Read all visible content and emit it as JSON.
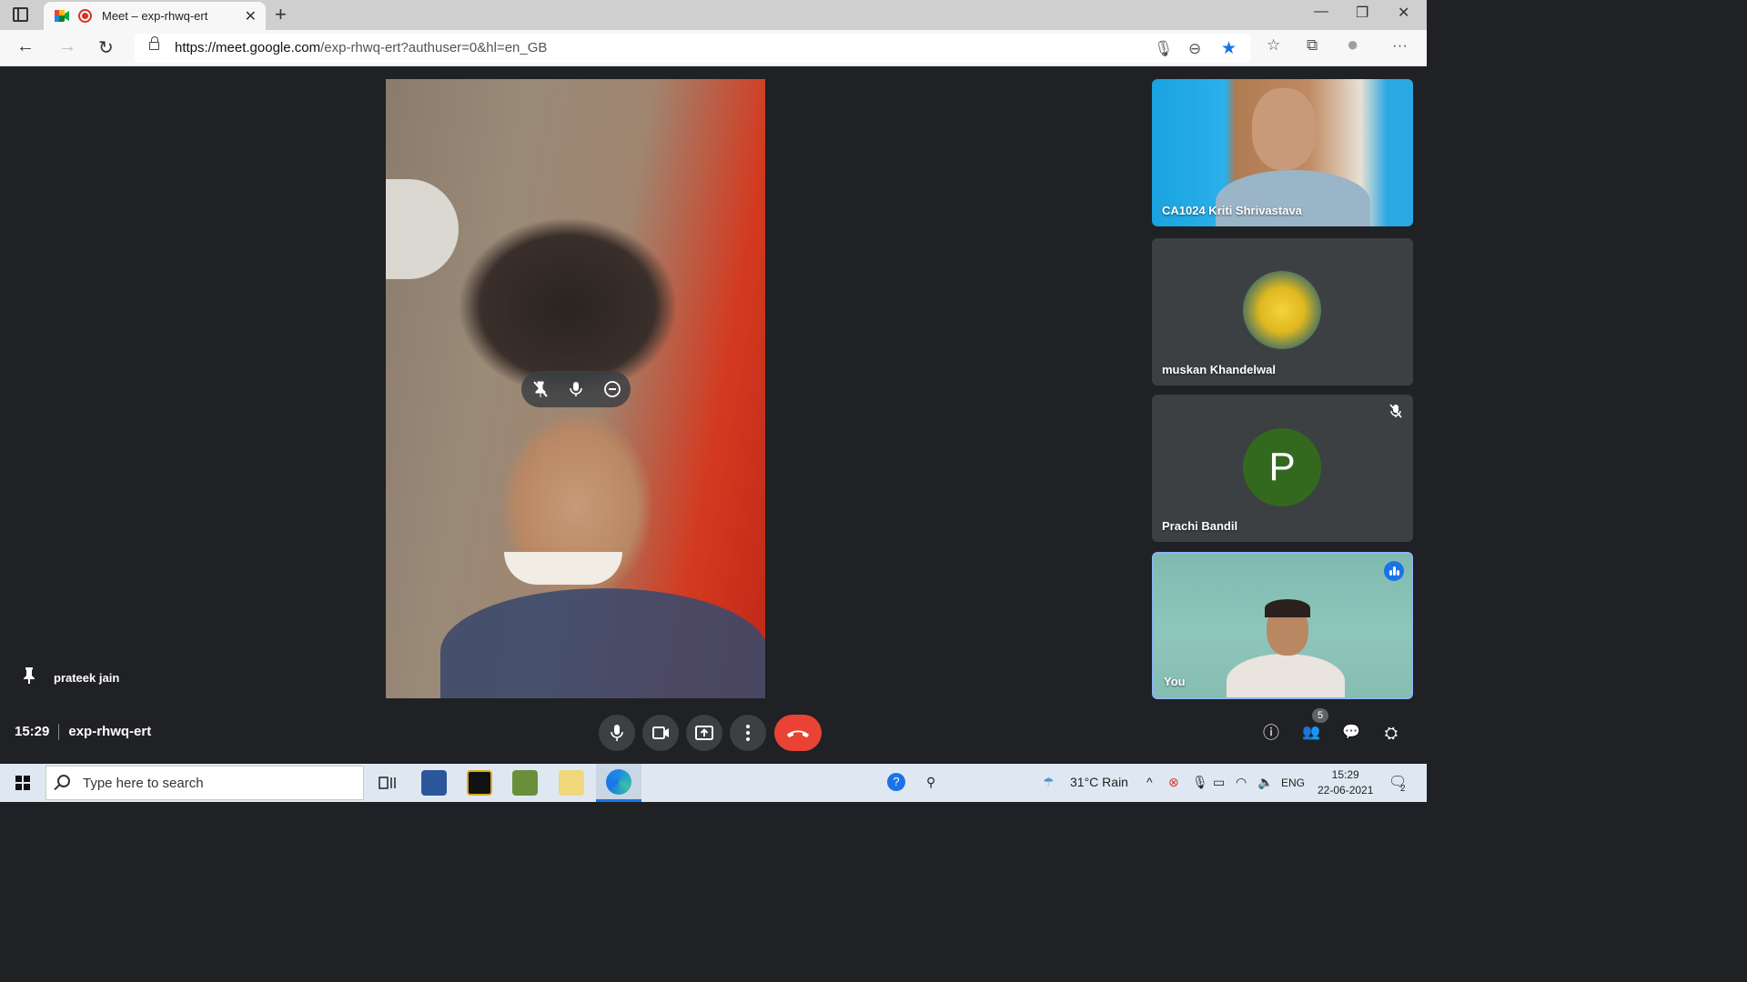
{
  "browser": {
    "tab_title": "Meet – exp-rhwq-ert",
    "tab_close": "✕",
    "new_tab": "+",
    "url_domain": "https://meet.google.com",
    "url_path": "/exp-rhwq-ert?authuser=0&hl=en_GB",
    "window_controls": {
      "minimize": "—",
      "maximize": "❐",
      "close": "✕"
    },
    "nav": {
      "back": "←",
      "forward": "→",
      "reload": "↻"
    },
    "addr_icons": {
      "mic": "🎙",
      "zoom": "⊖",
      "favorite": "★",
      "favorites": "☆",
      "collections": "⧉",
      "profile": "●",
      "more": "···"
    }
  },
  "meet": {
    "pinned_participant": "prateek jain",
    "time": "15:29",
    "meeting_code": "exp-rhwq-ert",
    "participants": [
      {
        "name": "CA1024 Kriti Shrivastava"
      },
      {
        "name": "muskan Khandelwal"
      },
      {
        "name": "Prachi Bandil",
        "initial": "P"
      },
      {
        "name": "You"
      }
    ],
    "people_count": "5",
    "controls": {
      "mic": "🎤",
      "camera": "📹",
      "present": "⬆",
      "more": "⋮"
    },
    "right_icons": {
      "info": "ⓘ",
      "people": "👥",
      "chat": "💬",
      "activities": "⛭"
    }
  },
  "taskbar": {
    "search_placeholder": "Type here to search",
    "weather": "31°C  Rain",
    "language": "ENG",
    "time": "15:29",
    "date": "22-06-2021",
    "notifications": "2"
  },
  "colors": {
    "meet_bg": "#202124",
    "tile_bg": "#3c4043",
    "end_call": "#ea4335",
    "active_speaker": "#8ab4f8",
    "avatar_green": "#33691e"
  }
}
